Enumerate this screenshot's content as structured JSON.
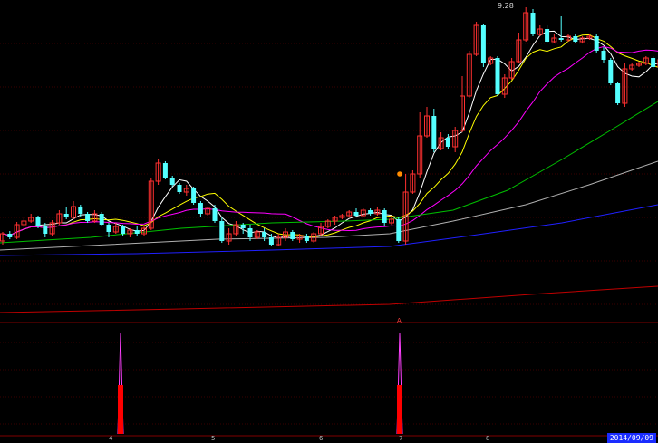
{
  "price_panel": {
    "high_label": "9.28"
  },
  "signal_panel": {
    "signal_marker": "A"
  },
  "time_axis": {
    "ticks": [
      "4",
      "5",
      "6",
      "7",
      "8"
    ],
    "current_date": "2014/09/09"
  },
  "colors": {
    "background": "#000000",
    "candle_up": "#ff3030",
    "candle_down": "#54ffff",
    "ma5": "#ffffff",
    "ma10": "#ffff00",
    "ma20": "#ff00ff",
    "ma60": "#00c000",
    "ma120": "#b0b0b0",
    "ma250": "#2020ff",
    "long_line": "#c00000",
    "signal_bar": "#ff0000",
    "signal_spike": "#ff40ff"
  },
  "chart_data": {
    "type": "candlestick",
    "candles": [
      [
        0,
        266,
        258,
        270,
        256
      ],
      [
        1,
        258,
        262,
        264,
        255
      ],
      [
        2,
        262,
        248,
        264,
        245
      ],
      [
        3,
        248,
        244,
        251,
        240
      ],
      [
        4,
        244,
        240,
        246,
        236
      ],
      [
        5,
        240,
        250,
        252,
        238
      ],
      [
        6,
        250,
        258,
        262,
        246
      ],
      [
        7,
        258,
        246,
        260,
        243
      ],
      [
        8,
        246,
        236,
        248,
        232
      ],
      [
        9,
        236,
        240,
        242,
        228
      ],
      [
        10,
        240,
        228,
        242,
        222
      ],
      [
        11,
        228,
        236,
        240,
        226
      ],
      [
        12,
        236,
        244,
        246,
        234
      ],
      [
        13,
        244,
        236,
        246,
        232
      ],
      [
        14,
        236,
        248,
        250,
        234
      ],
      [
        15,
        248,
        256,
        262,
        246
      ],
      [
        16,
        256,
        250,
        258,
        246
      ],
      [
        17,
        250,
        258,
        260,
        248
      ],
      [
        18,
        258,
        254,
        262,
        252
      ],
      [
        19,
        254,
        258,
        260,
        250
      ],
      [
        20,
        258,
        252,
        260,
        250
      ],
      [
        21,
        252,
        200,
        254,
        196
      ],
      [
        22,
        200,
        180,
        204,
        176
      ],
      [
        23,
        180,
        196,
        198,
        178
      ],
      [
        24,
        196,
        204,
        206,
        194
      ],
      [
        25,
        204,
        212,
        214,
        202
      ],
      [
        26,
        212,
        208,
        216,
        204
      ],
      [
        27,
        208,
        224,
        226,
        206
      ],
      [
        28,
        224,
        236,
        240,
        222
      ],
      [
        29,
        236,
        230,
        238,
        228
      ],
      [
        30,
        230,
        244,
        246,
        226
      ],
      [
        31,
        244,
        266,
        268,
        240
      ],
      [
        32,
        266,
        258,
        270,
        252
      ],
      [
        33,
        258,
        248,
        260,
        244
      ],
      [
        34,
        248,
        252,
        258,
        246
      ],
      [
        35,
        252,
        262,
        266,
        248
      ],
      [
        36,
        262,
        256,
        264,
        254
      ],
      [
        37,
        256,
        262,
        266,
        252
      ],
      [
        38,
        262,
        270,
        272,
        258
      ],
      [
        39,
        270,
        262,
        272,
        258
      ],
      [
        40,
        262,
        256,
        266,
        252
      ],
      [
        41,
        256,
        264,
        266,
        254
      ],
      [
        42,
        264,
        260,
        268,
        258
      ],
      [
        43,
        260,
        266,
        268,
        258
      ],
      [
        44,
        266,
        258,
        268,
        256
      ],
      [
        45,
        258,
        250,
        260,
        246
      ],
      [
        46,
        250,
        244,
        252,
        242
      ],
      [
        47,
        244,
        240,
        248,
        238
      ],
      [
        48,
        240,
        238,
        242,
        236
      ],
      [
        49,
        238,
        234,
        240,
        232
      ],
      [
        50,
        234,
        238,
        240,
        230
      ],
      [
        51,
        238,
        232,
        240,
        230
      ],
      [
        52,
        232,
        236,
        238,
        230
      ],
      [
        53,
        236,
        232,
        238,
        228
      ],
      [
        54,
        232,
        246,
        250,
        230
      ],
      [
        55,
        246,
        242,
        248,
        238
      ],
      [
        56,
        242,
        266,
        268,
        240
      ],
      [
        57,
        266,
        212,
        270,
        192
      ],
      [
        58,
        212,
        192,
        214,
        188
      ],
      [
        59,
        192,
        150,
        196,
        124
      ],
      [
        60,
        150,
        128,
        152,
        118
      ],
      [
        61,
        128,
        164,
        168,
        120
      ],
      [
        62,
        164,
        152,
        166,
        146
      ],
      [
        63,
        152,
        162,
        164,
        148
      ],
      [
        64,
        162,
        144,
        168,
        140
      ],
      [
        65,
        144,
        106,
        146,
        84
      ],
      [
        66,
        106,
        60,
        108,
        56
      ],
      [
        67,
        60,
        28,
        62,
        24
      ],
      [
        68,
        28,
        70,
        74,
        26
      ],
      [
        69,
        70,
        64,
        72,
        62
      ],
      [
        70,
        64,
        104,
        106,
        62
      ],
      [
        71,
        104,
        86,
        108,
        82
      ],
      [
        72,
        86,
        68,
        88,
        64
      ],
      [
        73,
        68,
        44,
        70,
        36
      ],
      [
        74,
        44,
        14,
        46,
        8
      ],
      [
        75,
        14,
        38,
        40,
        10
      ],
      [
        76,
        38,
        32,
        40,
        28
      ],
      [
        77,
        32,
        46,
        48,
        28
      ],
      [
        78,
        46,
        42,
        48,
        38
      ],
      [
        79,
        42,
        44,
        46,
        18
      ],
      [
        80,
        44,
        40,
        46,
        38
      ],
      [
        81,
        40,
        46,
        48,
        38
      ],
      [
        82,
        46,
        42,
        48,
        40
      ],
      [
        83,
        42,
        40,
        44,
        38
      ],
      [
        84,
        40,
        56,
        58,
        38
      ],
      [
        85,
        56,
        66,
        70,
        52
      ],
      [
        86,
        66,
        92,
        94,
        64
      ],
      [
        87,
        92,
        114,
        116,
        90
      ],
      [
        88,
        114,
        76,
        118,
        70
      ],
      [
        89,
        76,
        72,
        78,
        70
      ],
      [
        90,
        72,
        70,
        74,
        68
      ],
      [
        91,
        70,
        64,
        72,
        62
      ],
      [
        92,
        64,
        74,
        76,
        62
      ],
      [
        93,
        74,
        66,
        78,
        62
      ]
    ]
  }
}
